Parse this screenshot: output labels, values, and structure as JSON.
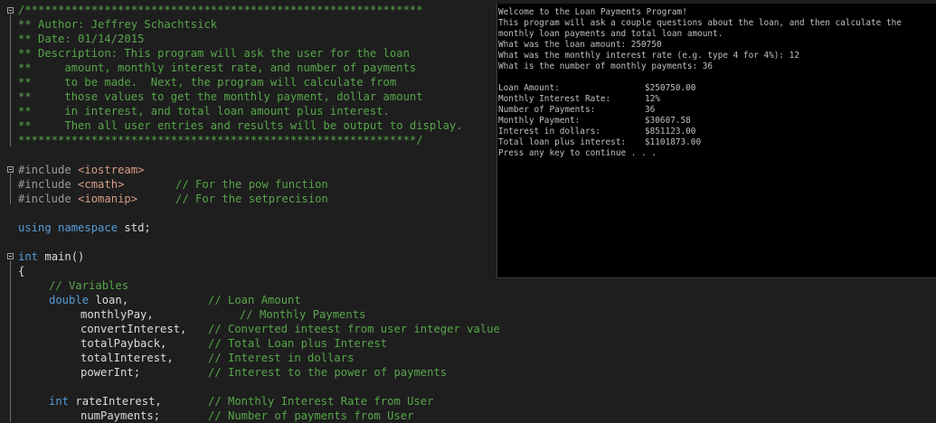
{
  "editor": {
    "lines": [
      {
        "id": "code-line-comment-open",
        "y": 3,
        "fold": true,
        "cls": "cm",
        "indent": 20,
        "text": "/************************************************************"
      },
      {
        "id": "code-line-author",
        "cls": "cm",
        "indent": 20,
        "text": "** Author: Jeffrey Schachtsick"
      },
      {
        "id": "code-line-date",
        "cls": "cm",
        "indent": 20,
        "text": "** Date: 01/14/2015"
      },
      {
        "id": "code-line-description",
        "cls": "cm",
        "indent": 20,
        "text": "** Description: This program will ask the user for the loan"
      },
      {
        "id": "code-line-description-2",
        "cls": "cm",
        "indent": 20,
        "text": "**     amount, monthly interest rate, and number of payments"
      },
      {
        "id": "code-line-description-3",
        "cls": "cm",
        "indent": 20,
        "text": "**     to be made.  Next, the program will calculate from"
      },
      {
        "id": "code-line-description-4",
        "cls": "cm",
        "indent": 20,
        "text": "**     those values to get the monthly payment, dollar amount"
      },
      {
        "id": "code-line-description-5",
        "cls": "cm",
        "indent": 20,
        "text": "**     in interest, and total loan amount plus interest."
      },
      {
        "id": "code-line-description-6",
        "cls": "cm",
        "indent": 20,
        "text": "**     Then all user entries and results will be output to display."
      },
      {
        "id": "code-line-comment-close",
        "cls": "cm",
        "indent": 20,
        "text": "************************************************************/"
      }
    ],
    "includes": {
      "directive": "#include",
      "items": [
        {
          "header": "<iostream>",
          "comment": ""
        },
        {
          "header": "<cmath>",
          "comment": "// For the pow function"
        },
        {
          "header": "<iomanip>",
          "comment": "// For the setprecision"
        }
      ]
    },
    "using_kw": "using",
    "namespace_kw": "namespace",
    "std_text": "std;",
    "int_kw": "int",
    "main_sig": "main()",
    "open_brace": "{",
    "comment_variables": "// Variables",
    "double_kw": "double",
    "double_decl": {
      "first": "loan,",
      "first_comment": "// Loan Amount",
      "rest": [
        {
          "name": "monthlyPay,",
          "comment": "// Monthly Payments",
          "comment_offset": true
        },
        {
          "name": "convertInterest,",
          "comment": "// Converted inteest from user integer value",
          "comment_offset": false
        },
        {
          "name": "totalPayback,",
          "comment": "// Total Loan plus Interest",
          "comment_offset": false
        },
        {
          "name": "totalInterest,",
          "comment": "// Interest in dollars",
          "comment_offset": false
        },
        {
          "name": "powerInt;",
          "comment": "// Interest to the power of payments",
          "comment_offset": false
        }
      ]
    },
    "int_decl": {
      "first": "rateInterest,",
      "first_comment": "// Monthly Interest Rate from User",
      "second": "numPayments;",
      "second_comment": "// Number of payments from User"
    }
  },
  "console": {
    "intro": [
      "Welcome to the Loan Payments Program!",
      "This program will ask a couple questions about the loan, and then calculate the",
      "monthly loan payments and total loan amount.",
      "What was the loan amount: 250750",
      "What was the monthly interest rate (e.g. type 4 for 4%): 12",
      "What is the number of monthly payments: 36"
    ],
    "results": [
      {
        "label": "Loan Amount:",
        "value": "$250750.00"
      },
      {
        "label": "Monthly Interest Rate:",
        "value": "12%"
      },
      {
        "label": "Number of Payments:",
        "value": "36"
      },
      {
        "label": "Monthly Payment:",
        "value": "$30607.58"
      },
      {
        "label": "Interest in dollars:",
        "value": "$851123.00"
      },
      {
        "label": "Total loan plus interest:",
        "value": "$1101873.00"
      }
    ],
    "footer": "Press any key to continue . . ."
  }
}
